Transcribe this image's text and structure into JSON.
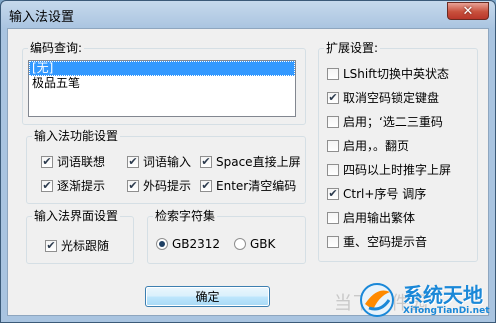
{
  "window": {
    "title": "输入法设置",
    "close_glyph": "✕"
  },
  "encoding": {
    "legend": "编码查询:",
    "items": [
      {
        "label": "[无]",
        "selected": true
      },
      {
        "label": "极品五笔",
        "selected": false
      }
    ]
  },
  "functions": {
    "legend": "输入法功能设置",
    "items": [
      {
        "label": "词语联想",
        "checked": true
      },
      {
        "label": "词语输入",
        "checked": true
      },
      {
        "label": "Space直接上屏",
        "checked": true
      },
      {
        "label": "逐渐提示",
        "checked": true
      },
      {
        "label": "外码提示",
        "checked": true
      },
      {
        "label": "Enter清空编码",
        "checked": true
      }
    ]
  },
  "interface": {
    "legend": "输入法界面设置",
    "cursor_follow": {
      "label": "光标跟随",
      "checked": true
    }
  },
  "charset": {
    "legend": "检索字符集",
    "options": [
      {
        "label": "GB2312",
        "selected": true
      },
      {
        "label": "GBK",
        "selected": false
      }
    ]
  },
  "extended": {
    "legend": "扩展设置:",
    "items": [
      {
        "label": "LShift切换中英状态",
        "checked": false
      },
      {
        "label": "取消空码锁定键盘",
        "checked": true
      },
      {
        "label": "启用；‘选二三重码",
        "checked": false
      },
      {
        "label": "启用，。翻页",
        "checked": false
      },
      {
        "label": "四码以上时推字上屏",
        "checked": false
      },
      {
        "label": "Ctrl+序号 调序",
        "checked": true
      },
      {
        "label": "启用输出繁体",
        "checked": false
      },
      {
        "label": "重、空码提示音",
        "checked": false
      }
    ]
  },
  "buttons": {
    "ok": "确定"
  },
  "watermark": {
    "text1": "当下软件园",
    "name": "系统天地",
    "url": "XiTongTianDi.net"
  },
  "colors": {
    "accent": "#3399ff",
    "title_bar": "#a9c4e0",
    "close_button": "#c8503c",
    "watermark_blue": "#1a88d8"
  }
}
